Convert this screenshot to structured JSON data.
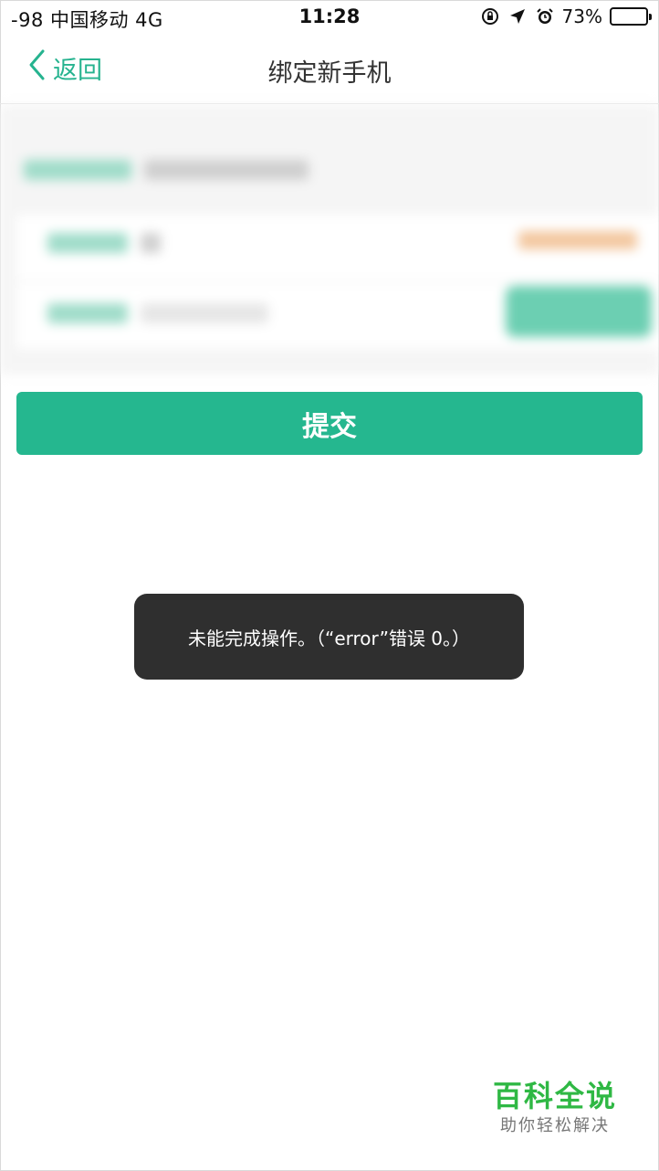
{
  "status_bar": {
    "carrier": "-98 中国移动  4G",
    "time": "11:28",
    "battery_percent_text": "73%",
    "battery_level": 0.73,
    "icons": [
      "rotation-lock-icon",
      "location-arrow-icon",
      "alarm-icon",
      "battery-icon"
    ]
  },
  "nav": {
    "back_label": "返回",
    "title": "绑定新手机"
  },
  "form": {
    "code_button_label": "",
    "note": "form contents are blurred in the screenshot"
  },
  "submit_label": "提交",
  "toast": {
    "message": "未能完成操作。（“error”错误 0。）"
  },
  "watermark": {
    "title": "百科全说",
    "subtitle": "助你轻松解决"
  },
  "colors": {
    "accent": "#25b78f",
    "toast_bg": "#2f2f2f",
    "watermark_green": "#2fb844"
  }
}
